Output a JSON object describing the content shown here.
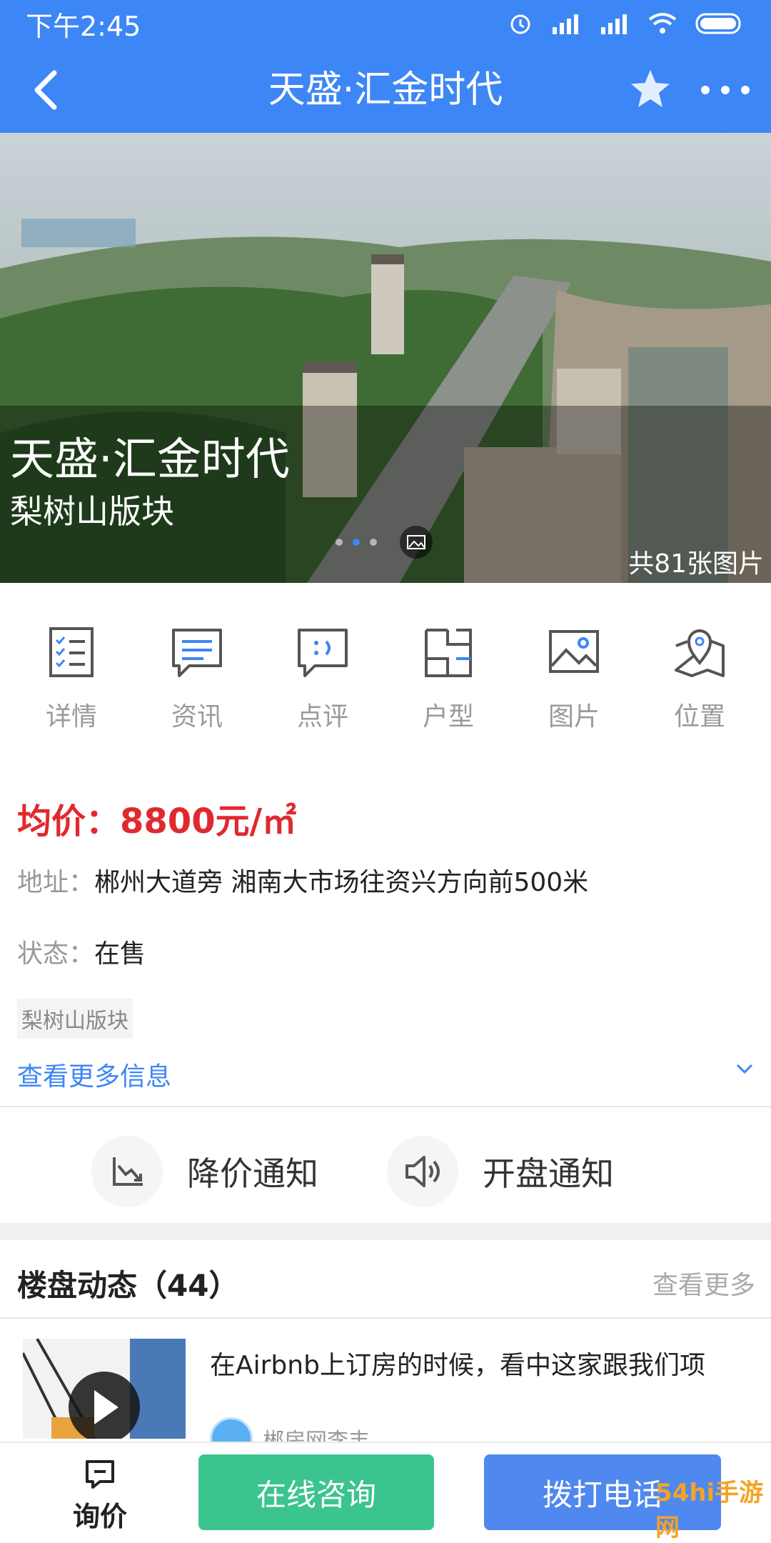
{
  "status_bar": {
    "time": "下午2:45"
  },
  "nav": {
    "title": "天盛·汇金时代"
  },
  "hero": {
    "title": "天盛·汇金时代",
    "subtitle": "梨树山版块",
    "photo_count": "共81张图片"
  },
  "quick_nav": {
    "items": [
      {
        "label": "详情",
        "icon": "list-check-icon"
      },
      {
        "label": "资讯",
        "icon": "news-icon"
      },
      {
        "label": "点评",
        "icon": "comment-icon"
      },
      {
        "label": "户型",
        "icon": "floorplan-icon"
      },
      {
        "label": "图片",
        "icon": "image-icon"
      },
      {
        "label": "位置",
        "icon": "map-pin-icon"
      }
    ]
  },
  "info": {
    "price": "均价：8800元/㎡",
    "address_key": "地址：",
    "address_value": "郴州大道旁 湘南大市场往资兴方向前500米",
    "status_key": "状态：",
    "status_value": "在售",
    "tag": "梨树山版块",
    "more_link": "查看更多信息"
  },
  "notify": {
    "price_drop": "降价通知",
    "opening": "开盘通知"
  },
  "news": {
    "title": "楼盘动态（44）",
    "more": "查看更多",
    "item_text": "在Airbnb上订房的时候，看中这家跟我们项",
    "item_author": "郴房网李丰"
  },
  "bottom": {
    "ask_label": "询价",
    "consult": "在线咨询",
    "call": "拨打电话"
  },
  "watermark": "54hi手游网",
  "colors": {
    "primary": "#3d86f5",
    "price": "#e0292f",
    "green": "#3cc48f",
    "blue": "#4f88ee"
  }
}
